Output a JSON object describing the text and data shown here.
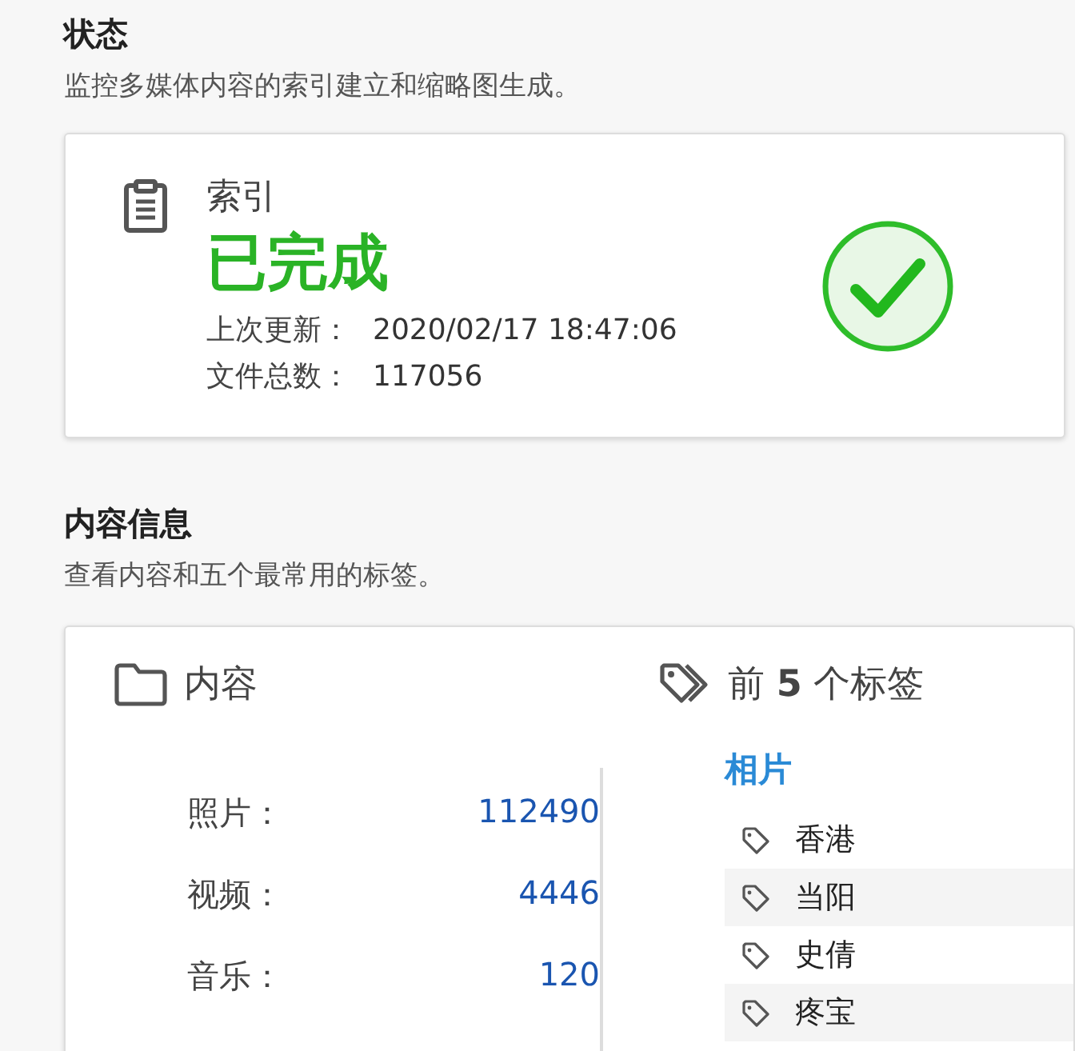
{
  "status_section": {
    "title": "状态",
    "description": "监控多媒体内容的索引建立和缩略图生成。",
    "index_card": {
      "label": "索引",
      "state": "已完成",
      "completed": true,
      "details": [
        {
          "label": "上次更新：",
          "value": "2020/02/17 18:47:06"
        },
        {
          "label": "文件总数：",
          "value": "117056"
        }
      ]
    }
  },
  "content_section": {
    "title": "内容信息",
    "description": "查看内容和五个最常用的标签。",
    "content": {
      "heading": "内容",
      "stats": [
        {
          "label": "照片：",
          "value": "112490"
        },
        {
          "label": "视频：",
          "value": "4446"
        },
        {
          "label": "音乐：",
          "value": "120"
        }
      ]
    },
    "tags": {
      "heading": "前 **5** 个标签",
      "category": "相片",
      "items": [
        "香港",
        "当阳",
        "史倩",
        "疼宝"
      ]
    }
  }
}
